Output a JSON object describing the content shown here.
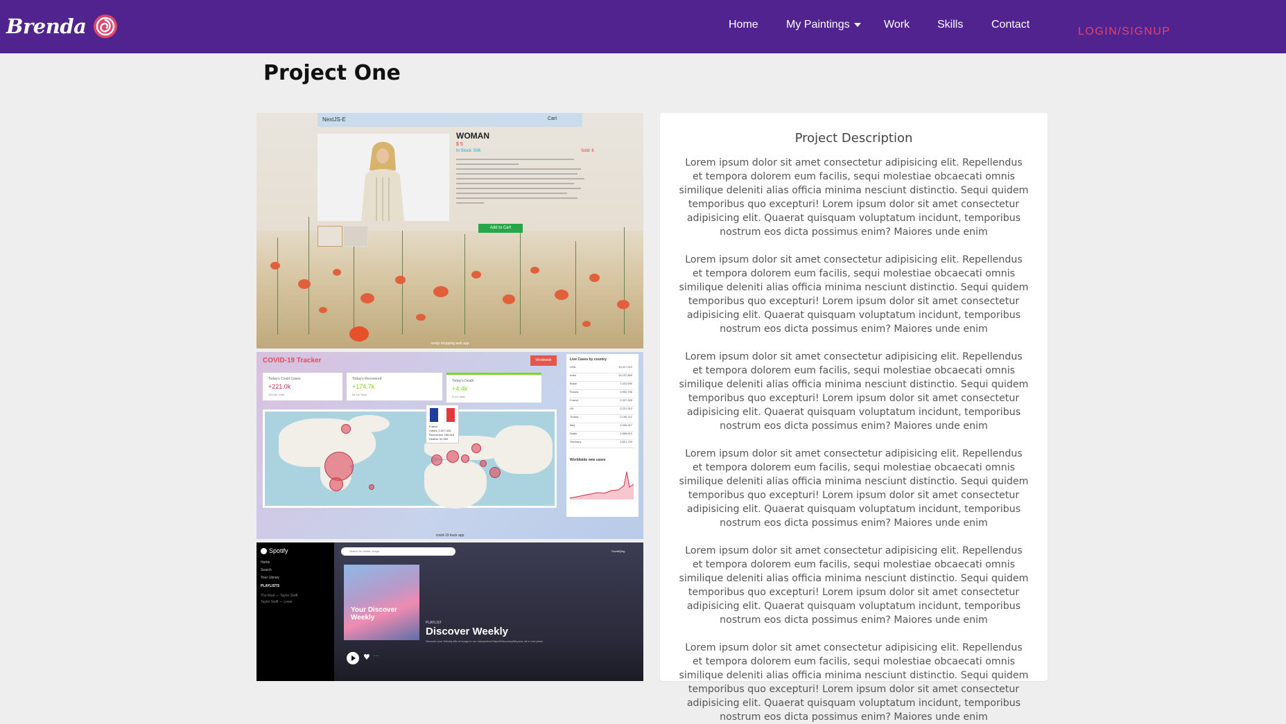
{
  "navbar": {
    "brand": "Brenda",
    "links": [
      {
        "label": "Home"
      },
      {
        "label": "My Paintings"
      },
      {
        "label": "Work"
      },
      {
        "label": "Skills"
      },
      {
        "label": "Contact"
      }
    ],
    "login_label": "LOGIN/SIGNUP",
    "colors": {
      "background": "#51238f",
      "accent": "#e2456b"
    }
  },
  "page": {
    "title": "Project One"
  },
  "screenshots": {
    "shop": {
      "bar_brand": "NextJS-E",
      "cart": "Cart",
      "product_title": "WOMAN",
      "price": "$ 5",
      "stock": "In Stock: 506",
      "sold": "Sold: 6",
      "add_to_cart": "Add to Cart",
      "caption": "nextjs shopping web app"
    },
    "covid": {
      "title": "COVID-19 Tracker",
      "dropdown": "Worldwide",
      "cards": [
        {
          "label": "Today's Covid Cases",
          "value": "+221.0k",
          "sub": "145.8m Total"
        },
        {
          "label": "Today's Recovered",
          "value": "+174.7k",
          "sub": "84.2m Total"
        },
        {
          "label": "Today's Death",
          "value": "+4.4k",
          "sub": "3.1m Total"
        }
      ],
      "popup": {
        "country": "France",
        "cases": "Cases: 2,327,325",
        "recovered": "Recovered: 168,818",
        "deaths": "Deaths: 92,260"
      },
      "side_title": "Live Cases by country",
      "countries": [
        {
          "name": "USA",
          "value": "19,117,212"
        },
        {
          "name": "India",
          "value": "10,107,869"
        },
        {
          "name": "Brazil",
          "value": "7,423,590"
        },
        {
          "name": "Russia",
          "value": "2,992,706"
        },
        {
          "name": "France",
          "value": "2,327,325"
        },
        {
          "name": "UK",
          "value": "2,221,312"
        },
        {
          "name": "Turkey",
          "value": "2,190,712"
        },
        {
          "name": "Italy",
          "value": "2,009,317"
        },
        {
          "name": "Spain",
          "value": "1,869,610"
        },
        {
          "name": "Germany",
          "value": "1,621,720"
        }
      ],
      "chart_title": "Worldwide new cases",
      "caption": "covid-19 track app"
    },
    "spotify": {
      "logo": "Spotify",
      "nav": [
        "Home",
        "Search",
        "Your Library"
      ],
      "playlists_label": "PLAYLISTS",
      "playlists": [
        "The Rest — Taylor Swift",
        "Taylor Swift — Lover"
      ],
      "search_placeholder": "Search for Artists, songs",
      "user": "SocialQing",
      "cover_text": "Your Discover Weekly",
      "label": "PLAYLIST",
      "title": "Discover Weekly",
      "description": "Discover your Weekly Mix of songs to our handpicked Rapid/Discovery/Beyond; all in one place."
    }
  },
  "description": {
    "title": "Project Description",
    "paragraphs": [
      "Lorem ipsum dolor sit amet consectetur adipisicing elit. Repellendus et tempora dolorem eum facilis, sequi molestiae obcaecati omnis similique deleniti alias officia minima nesciunt distinctio. Sequi quidem temporibus quo excepturi! Lorem ipsum dolor sit amet consectetur adipisicing elit. Quaerat quisquam voluptatum incidunt, temporibus nostrum eos dicta possimus enim? Maiores unde enim",
      "Lorem ipsum dolor sit amet consectetur adipisicing elit. Repellendus et tempora dolorem eum facilis, sequi molestiae obcaecati omnis similique deleniti alias officia minima nesciunt distinctio. Sequi quidem temporibus quo excepturi! Lorem ipsum dolor sit amet consectetur adipisicing elit. Quaerat quisquam voluptatum incidunt, temporibus nostrum eos dicta possimus enim? Maiores unde enim",
      "Lorem ipsum dolor sit amet consectetur adipisicing elit. Repellendus et tempora dolorem eum facilis, sequi molestiae obcaecati omnis similique deleniti alias officia minima nesciunt distinctio. Sequi quidem temporibus quo excepturi! Lorem ipsum dolor sit amet consectetur adipisicing elit. Quaerat quisquam voluptatum incidunt, temporibus nostrum eos dicta possimus enim? Maiores unde enim",
      "Lorem ipsum dolor sit amet consectetur adipisicing elit. Repellendus et tempora dolorem eum facilis, sequi molestiae obcaecati omnis similique deleniti alias officia minima nesciunt distinctio. Sequi quidem temporibus quo excepturi! Lorem ipsum dolor sit amet consectetur adipisicing elit. Quaerat quisquam voluptatum incidunt, temporibus nostrum eos dicta possimus enim? Maiores unde enim",
      "Lorem ipsum dolor sit amet consectetur adipisicing elit. Repellendus et tempora dolorem eum facilis, sequi molestiae obcaecati omnis similique deleniti alias officia minima nesciunt distinctio. Sequi quidem temporibus quo excepturi! Lorem ipsum dolor sit amet consectetur adipisicing elit. Quaerat quisquam voluptatum incidunt, temporibus nostrum eos dicta possimus enim? Maiores unde enim",
      "Lorem ipsum dolor sit amet consectetur adipisicing elit. Repellendus et tempora dolorem eum facilis, sequi molestiae obcaecati omnis similique deleniti alias officia minima nesciunt distinctio. Sequi quidem temporibus quo excepturi! Lorem ipsum dolor sit amet consectetur adipisicing elit. Quaerat quisquam voluptatum incidunt, temporibus nostrum eos dicta possimus enim? Maiores unde enim"
    ]
  }
}
